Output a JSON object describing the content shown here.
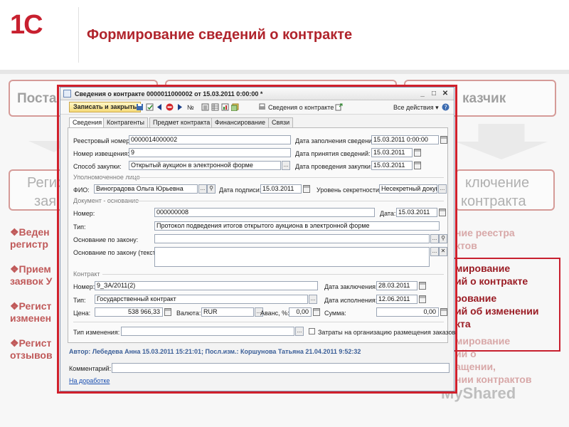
{
  "slide": {
    "logo": "1С",
    "title": "Формирование сведений о контракте",
    "bg_boxes": {
      "top_left": "Поста",
      "top_right": "казчик",
      "mid_left_1": "Регис",
      "mid_left_2": "зая",
      "mid_right_1": "ключение",
      "mid_right_2": "контракта"
    },
    "bullets_left": [
      "❖Веден",
      "регистр",
      "❖Прием",
      "заявок У",
      "❖Регист",
      "изменен",
      "❖Регист",
      "отзывов"
    ],
    "bullets_right": [
      "ние реестра",
      "ктов",
      "мирование",
      "ий о контракте",
      "рование",
      "ий об изменении",
      "кта",
      "мирование",
      "ий о",
      "ащении,",
      "нии контрактов"
    ],
    "watermark": "MyShared"
  },
  "dialog": {
    "title": "Сведения о контракте 0000011000002 от 15.03.2011 0:00:00 *",
    "window_buttons": [
      "_",
      "□",
      "✕"
    ],
    "toolbar": {
      "save_close": "Записать и закрыть",
      "number_sign": "№",
      "print_item": "Сведения о контракте",
      "all_actions": "Все действия ▾"
    },
    "tabs": [
      "Сведения",
      "Контрагенты",
      "Предмет контракта",
      "Финансирование",
      "Связи"
    ],
    "fields": {
      "registry_number_label": "Реестровый номер:",
      "registry_number": "0000014000002",
      "fill_date_label": "Дата заполнения сведений:",
      "fill_date": "15.03.2011 0:00:00",
      "notice_number_label": "Номер извещения:",
      "notice_number": "9",
      "accept_date_label": "Дата принятия сведений:",
      "accept_date": "15.03.2011",
      "procurement_method_label": "Способ закупки:",
      "procurement_method": "Открытый аукцион в электронной форме",
      "procurement_date_label": "Дата проведения закупки:",
      "procurement_date": "15.03.2011",
      "authorized_group": "Уполномоченное лицо",
      "fio_label": "ФИО:",
      "fio": "Виноградова Ольга Юрьевна",
      "sign_date_label": "Дата подписи:",
      "sign_date": "15.03.2011",
      "secrecy_label": "Уровень секретности:",
      "secrecy": "Несекретный докуме",
      "doc_basis_group": "Документ - основание",
      "basis_number_label": "Номер:",
      "basis_number": "000000008",
      "basis_date_label": "Дата:",
      "basis_date": "15.03.2011",
      "basis_type_label": "Тип:",
      "basis_type": "Протокол подведения итогов открытого аукциона в электронной форме",
      "law_basis_label": "Основание по закону:",
      "law_basis": "",
      "law_basis_text_label": "Основание по закону (текст):",
      "law_basis_text": "",
      "contract_group": "Контракт",
      "contract_number_label": "Номер:",
      "contract_number": "9_ЗА/2011(2)",
      "conclusion_date_label": "Дата заключения:",
      "conclusion_date": "28.03.2011",
      "contract_type_label": "Тип:",
      "contract_type": "Государственный контракт",
      "execution_date_label": "Дата исполнения:",
      "execution_date": "12.06.2011",
      "price_label": "Цена:",
      "price": "538 966,33",
      "currency_label": "Валюта:",
      "currency": "RUR",
      "advance_label": "Аванс, %:",
      "advance": "0,00",
      "sum_label": "Сумма:",
      "sum": "0,00",
      "change_type_label": "Тип изменения:",
      "change_type": "",
      "costs_checkbox_label": "Затраты на организацию размещения заказов"
    },
    "author_line": "Автор: Лебедева Анна 15.03.2011 15:21:01; Посл.изм.: Коршунова Татьяна 21.04.2011 9:52:32",
    "comment_label": "Комментарий:",
    "comment": "",
    "status_link": "На доработке"
  },
  "colors": {
    "brand_red": "#c8202f",
    "title_red": "#b0242c",
    "link_blue": "#1a4fb0"
  }
}
